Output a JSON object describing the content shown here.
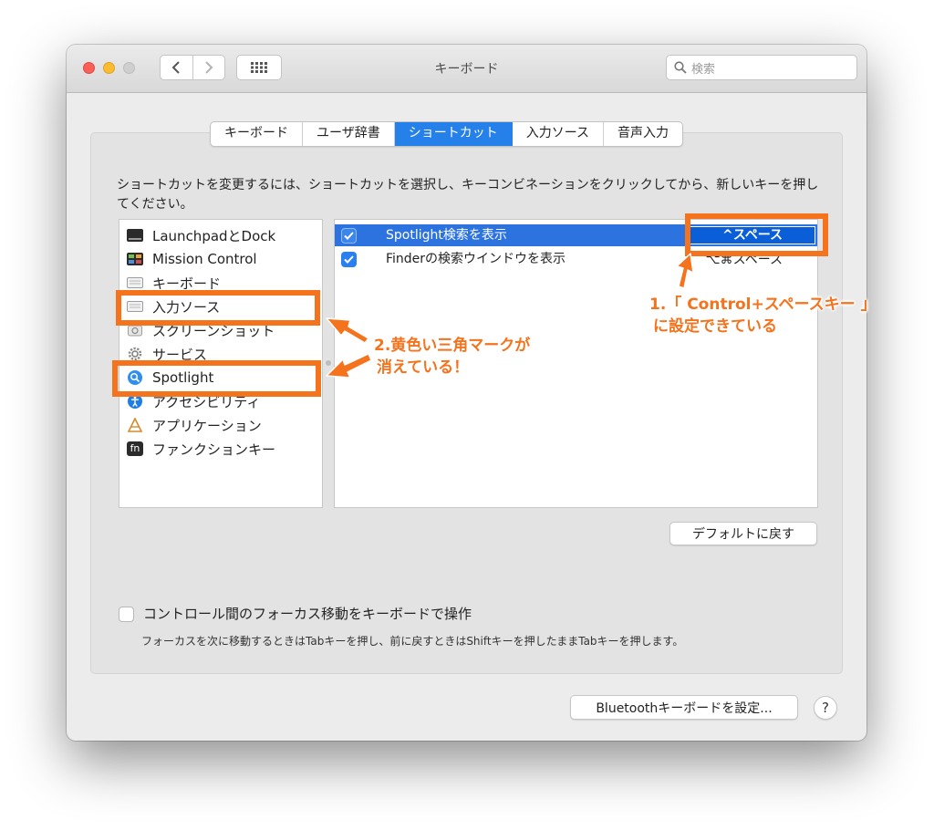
{
  "window": {
    "title": "キーボード"
  },
  "search": {
    "placeholder": "検索"
  },
  "tabs": [
    {
      "label": "キーボード"
    },
    {
      "label": "ユーザ辞書"
    },
    {
      "label": "ショートカット"
    },
    {
      "label": "入力ソース"
    },
    {
      "label": "音声入力"
    }
  ],
  "active_tab": "ショートカット",
  "description": "ショートカットを変更するには、ショートカットを選択し、キーコンビネーションをクリックしてから、新しいキーを押してください。",
  "categories": [
    {
      "label": "LaunchpadとDock",
      "icon": "launchpad-icon"
    },
    {
      "label": "Mission Control",
      "icon": "mission-control-icon"
    },
    {
      "label": "キーボード",
      "icon": "keyboard-icon"
    },
    {
      "label": "入力ソース",
      "icon": "keyboard-icon"
    },
    {
      "label": "スクリーンショット",
      "icon": "screenshot-icon"
    },
    {
      "label": "サービス",
      "icon": "gear-icon"
    },
    {
      "label": "Spotlight",
      "icon": "spotlight-icon"
    },
    {
      "label": "アクセシビリティ",
      "icon": "accessibility-icon"
    },
    {
      "label": "アプリケーション",
      "icon": "applications-icon"
    },
    {
      "label": "ファンクションキー",
      "icon": "fn-key-icon"
    }
  ],
  "fn_label": "fn",
  "shortcuts": [
    {
      "label": "Spotlight検索を表示",
      "key": "^スペース",
      "checked": true,
      "selected": true
    },
    {
      "label": "Finderの検索ウインドウを表示",
      "key": "⌥⌘スペース",
      "checked": true,
      "selected": false
    }
  ],
  "buttons": {
    "restore_defaults": "デフォルトに戻す",
    "bluetooth": "Bluetoothキーボードを設定...",
    "help": "?"
  },
  "focus_option": {
    "label": "コントロール間のフォーカス移動をキーボードで操作",
    "checked": false,
    "note": "フォーカスを次に移動するときはTabキーを押し、前に戻すときはShiftキーを押したままTabキーを押します。"
  },
  "annotations": {
    "note1_line1": "1.「 Control+スペースキー 」",
    "note1_line2": "に設定できている",
    "note2_line1": "2.黄色い三角マークが",
    "note2_line2": "消えている！",
    "color": "#f4731c"
  },
  "colors": {
    "accent": "#2680e9",
    "selection": "#2d73e0"
  }
}
